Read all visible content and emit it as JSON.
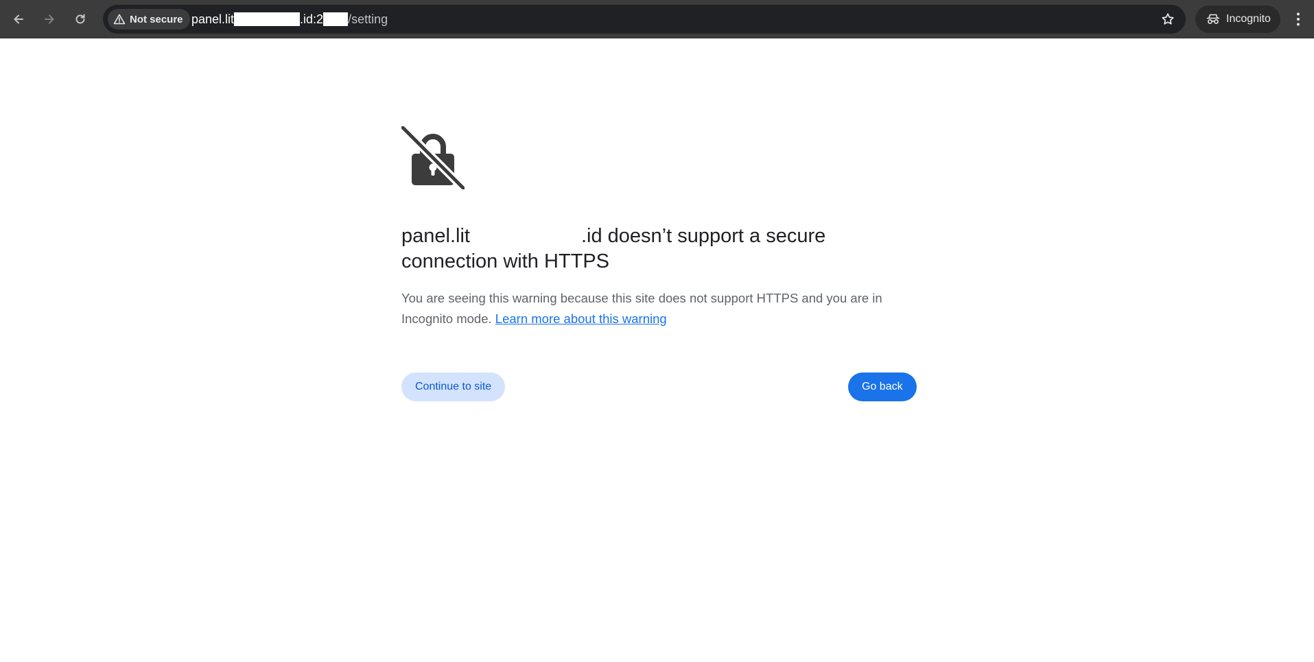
{
  "toolbar": {
    "back_icon": "arrow-left-icon",
    "forward_icon": "arrow-right-icon",
    "reload_icon": "reload-icon",
    "security_label": "Not secure",
    "url": {
      "part1": "panel.lit",
      "part2": ".id:2",
      "part3": "/setting"
    },
    "bookmark_icon": "star-icon",
    "profile_label": "Incognito",
    "menu_icon": "kebab-menu-icon"
  },
  "interstitial": {
    "icon": "lock-crossed-icon",
    "heading_part1": "panel.lit",
    "heading_part2": ".id doesn’t support a secure connection with HTTPS",
    "body": "You are seeing this warning because this site does not support HTTPS and you are in Incognito mode.",
    "learn_more_link": "Learn more about this warning",
    "continue_button": "Continue to site",
    "go_back_button": "Go back"
  },
  "colors": {
    "toolbar_bg": "#3c3c3c",
    "omnibox_bg": "#202124",
    "primary_blue": "#1a73e8",
    "secondary_button_bg": "#d3e3fd",
    "heading_text": "#202124",
    "body_text": "#5f6368"
  }
}
